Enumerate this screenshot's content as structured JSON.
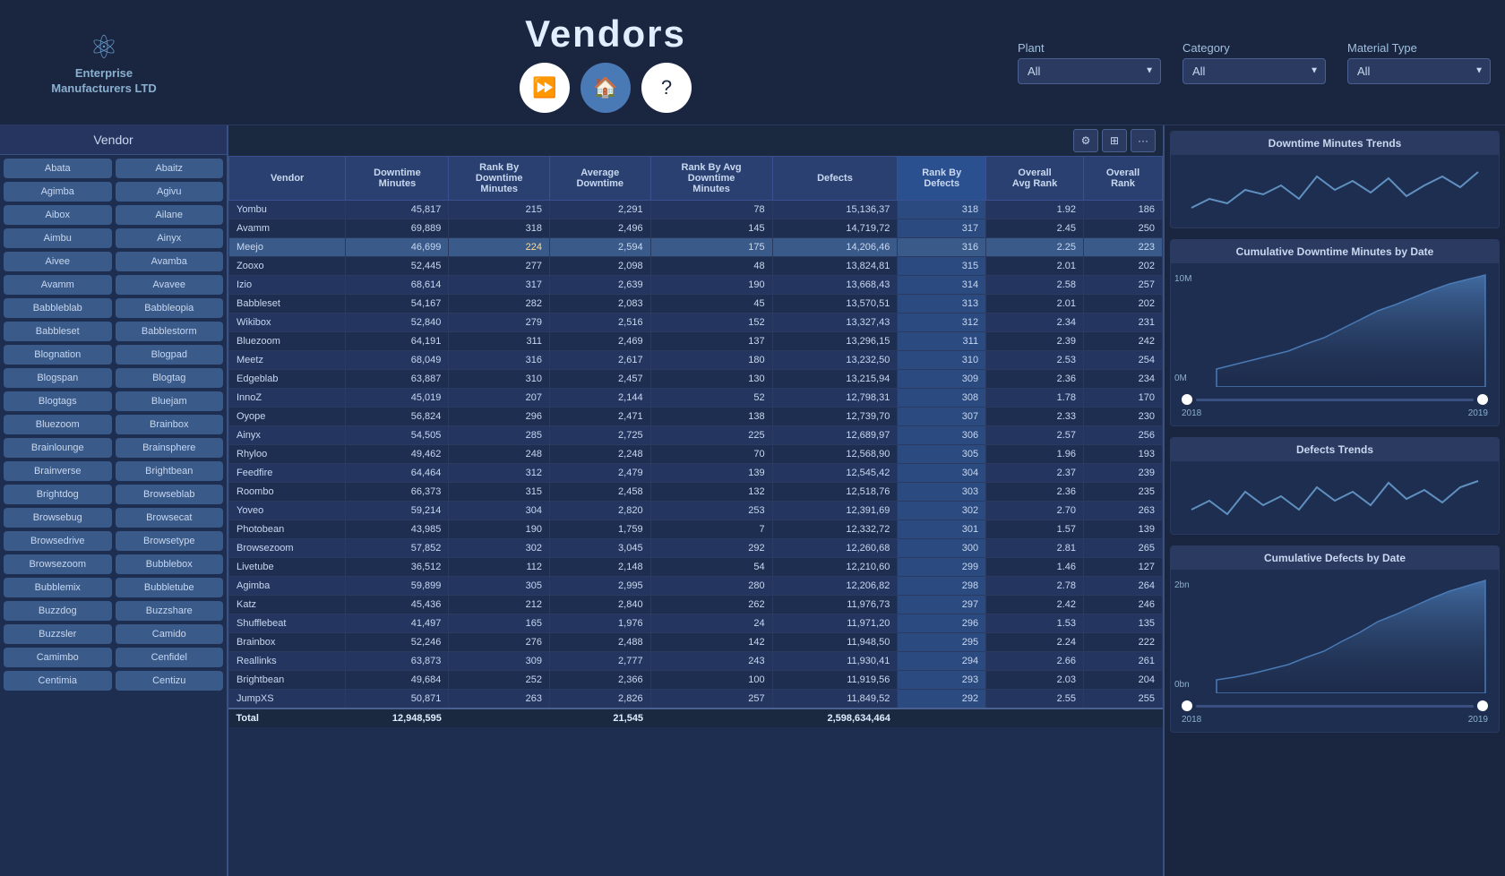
{
  "header": {
    "logo_line1": "Enterprise",
    "logo_line2": "Manufacturers LTD",
    "title": "Vendors",
    "nav": {
      "home_label": "🏠",
      "forward_label": "⏩",
      "help_label": "?"
    },
    "filters": {
      "plant_label": "Plant",
      "plant_value": "All",
      "category_label": "Category",
      "category_value": "All",
      "material_type_label": "Material Type",
      "material_type_value": "All"
    }
  },
  "sidebar": {
    "header": "Vendor",
    "vendors": [
      "Abata",
      "Abaitz",
      "Agimba",
      "Agivu",
      "Aibox",
      "Ailane",
      "Aimbu",
      "Ainyx",
      "Aivee",
      "Avamba",
      "Avamm",
      "Avavee",
      "Babbleblab",
      "Babbleopia",
      "Babbleset",
      "Babblestorm",
      "Blognation",
      "Blogpad",
      "Blogspan",
      "Blogtag",
      "Blogtags",
      "Bluejam",
      "Bluezoom",
      "Brainbox",
      "Brainlounge",
      "Brainsphere",
      "Brainverse",
      "Brightbean",
      "Brightdog",
      "Browseblab",
      "Browsebug",
      "Browsecat",
      "Browsedrive",
      "Browsetype",
      "Browsezoom",
      "Bubblebox",
      "Bubblemix",
      "Bubbletube",
      "Buzzdog",
      "Buzzshare",
      "Buzzsler",
      "Camido",
      "Camimbo",
      "Cenfidel",
      "Centimia",
      "Centizu"
    ]
  },
  "table": {
    "columns": [
      "Vendor",
      "Downtime Minutes",
      "Rank By Downtime Minutes",
      "Average Downtime",
      "Rank By Avg Downtime Minutes",
      "Defects",
      "Rank By Defects",
      "Overall Avg Rank",
      "Overall Rank"
    ],
    "rows": [
      {
        "vendor": "Yombu",
        "downtime": "45,817",
        "rank_down": "215",
        "avg_down": "2,291",
        "rank_avg": "78",
        "defects": "15,136,37",
        "rank_def": "318",
        "avg_rank": "1.92",
        "overall": "186"
      },
      {
        "vendor": "Avamm",
        "downtime": "69,889",
        "rank_down": "318",
        "avg_down": "2,496",
        "rank_avg": "145",
        "defects": "14,719,72",
        "rank_def": "317",
        "avg_rank": "2.45",
        "overall": "250"
      },
      {
        "vendor": "Meejo",
        "downtime": "46,699",
        "rank_down": "224",
        "avg_down": "2,594",
        "rank_avg": "175",
        "defects": "14,206,46",
        "rank_def": "316",
        "avg_rank": "2.25",
        "overall": "223",
        "highlight": true
      },
      {
        "vendor": "Zooxo",
        "downtime": "52,445",
        "rank_down": "277",
        "avg_down": "2,098",
        "rank_avg": "48",
        "defects": "13,824,81",
        "rank_def": "315",
        "avg_rank": "2.01",
        "overall": "202"
      },
      {
        "vendor": "Izio",
        "downtime": "68,614",
        "rank_down": "317",
        "avg_down": "2,639",
        "rank_avg": "190",
        "defects": "13,668,43",
        "rank_def": "314",
        "avg_rank": "2.58",
        "overall": "257"
      },
      {
        "vendor": "Babbleset",
        "downtime": "54,167",
        "rank_down": "282",
        "avg_down": "2,083",
        "rank_avg": "45",
        "defects": "13,570,51",
        "rank_def": "313",
        "avg_rank": "2.01",
        "overall": "202"
      },
      {
        "vendor": "Wikibox",
        "downtime": "52,840",
        "rank_down": "279",
        "avg_down": "2,516",
        "rank_avg": "152",
        "defects": "13,327,43",
        "rank_def": "312",
        "avg_rank": "2.34",
        "overall": "231"
      },
      {
        "vendor": "Bluezoom",
        "downtime": "64,191",
        "rank_down": "311",
        "avg_down": "2,469",
        "rank_avg": "137",
        "defects": "13,296,15",
        "rank_def": "311",
        "avg_rank": "2.39",
        "overall": "242"
      },
      {
        "vendor": "Meetz",
        "downtime": "68,049",
        "rank_down": "316",
        "avg_down": "2,617",
        "rank_avg": "180",
        "defects": "13,232,50",
        "rank_def": "310",
        "avg_rank": "2.53",
        "overall": "254"
      },
      {
        "vendor": "Edgeblab",
        "downtime": "63,887",
        "rank_down": "310",
        "avg_down": "2,457",
        "rank_avg": "130",
        "defects": "13,215,94",
        "rank_def": "309",
        "avg_rank": "2.36",
        "overall": "234"
      },
      {
        "vendor": "InnoZ",
        "downtime": "45,019",
        "rank_down": "207",
        "avg_down": "2,144",
        "rank_avg": "52",
        "defects": "12,798,31",
        "rank_def": "308",
        "avg_rank": "1.78",
        "overall": "170"
      },
      {
        "vendor": "Oyope",
        "downtime": "56,824",
        "rank_down": "296",
        "avg_down": "2,471",
        "rank_avg": "138",
        "defects": "12,739,70",
        "rank_def": "307",
        "avg_rank": "2.33",
        "overall": "230"
      },
      {
        "vendor": "Ainyx",
        "downtime": "54,505",
        "rank_down": "285",
        "avg_down": "2,725",
        "rank_avg": "225",
        "defects": "12,689,97",
        "rank_def": "306",
        "avg_rank": "2.57",
        "overall": "256"
      },
      {
        "vendor": "Rhyloo",
        "downtime": "49,462",
        "rank_down": "248",
        "avg_down": "2,248",
        "rank_avg": "70",
        "defects": "12,568,90",
        "rank_def": "305",
        "avg_rank": "1.96",
        "overall": "193"
      },
      {
        "vendor": "Feedfire",
        "downtime": "64,464",
        "rank_down": "312",
        "avg_down": "2,479",
        "rank_avg": "139",
        "defects": "12,545,42",
        "rank_def": "304",
        "avg_rank": "2.37",
        "overall": "239"
      },
      {
        "vendor": "Roombo",
        "downtime": "66,373",
        "rank_down": "315",
        "avg_down": "2,458",
        "rank_avg": "132",
        "defects": "12,518,76",
        "rank_def": "303",
        "avg_rank": "2.36",
        "overall": "235"
      },
      {
        "vendor": "Yoveo",
        "downtime": "59,214",
        "rank_down": "304",
        "avg_down": "2,820",
        "rank_avg": "253",
        "defects": "12,391,69",
        "rank_def": "302",
        "avg_rank": "2.70",
        "overall": "263"
      },
      {
        "vendor": "Photobean",
        "downtime": "43,985",
        "rank_down": "190",
        "avg_down": "1,759",
        "rank_avg": "7",
        "defects": "12,332,72",
        "rank_def": "301",
        "avg_rank": "1.57",
        "overall": "139"
      },
      {
        "vendor": "Browsezoom",
        "downtime": "57,852",
        "rank_down": "302",
        "avg_down": "3,045",
        "rank_avg": "292",
        "defects": "12,260,68",
        "rank_def": "300",
        "avg_rank": "2.81",
        "overall": "265"
      },
      {
        "vendor": "Livetube",
        "downtime": "36,512",
        "rank_down": "112",
        "avg_down": "2,148",
        "rank_avg": "54",
        "defects": "12,210,60",
        "rank_def": "299",
        "avg_rank": "1.46",
        "overall": "127"
      },
      {
        "vendor": "Agimba",
        "downtime": "59,899",
        "rank_down": "305",
        "avg_down": "2,995",
        "rank_avg": "280",
        "defects": "12,206,82",
        "rank_def": "298",
        "avg_rank": "2.78",
        "overall": "264"
      },
      {
        "vendor": "Katz",
        "downtime": "45,436",
        "rank_down": "212",
        "avg_down": "2,840",
        "rank_avg": "262",
        "defects": "11,976,73",
        "rank_def": "297",
        "avg_rank": "2.42",
        "overall": "246"
      },
      {
        "vendor": "Shufflebeat",
        "downtime": "41,497",
        "rank_down": "165",
        "avg_down": "1,976",
        "rank_avg": "24",
        "defects": "11,971,20",
        "rank_def": "296",
        "avg_rank": "1.53",
        "overall": "135"
      },
      {
        "vendor": "Brainbox",
        "downtime": "52,246",
        "rank_down": "276",
        "avg_down": "2,488",
        "rank_avg": "142",
        "defects": "11,948,50",
        "rank_def": "295",
        "avg_rank": "2.24",
        "overall": "222"
      },
      {
        "vendor": "Reallinks",
        "downtime": "63,873",
        "rank_down": "309",
        "avg_down": "2,777",
        "rank_avg": "243",
        "defects": "11,930,41",
        "rank_def": "294",
        "avg_rank": "2.66",
        "overall": "261"
      },
      {
        "vendor": "Brightbean",
        "downtime": "49,684",
        "rank_down": "252",
        "avg_down": "2,366",
        "rank_avg": "100",
        "defects": "11,919,56",
        "rank_def": "293",
        "avg_rank": "2.03",
        "overall": "204"
      },
      {
        "vendor": "JumpXS",
        "downtime": "50,871",
        "rank_down": "263",
        "avg_down": "2,826",
        "rank_avg": "257",
        "defects": "11,849,52",
        "rank_def": "292",
        "avg_rank": "2.55",
        "overall": "255"
      }
    ],
    "footer": {
      "label": "Total",
      "downtime": "12,948,595",
      "avg_down": "21,545",
      "defects": "2,598,634,464"
    }
  },
  "charts": {
    "downtime_trends": {
      "title": "Downtime Minutes Trends",
      "subtitle": "Cumulative Downtime Minutes by Date",
      "y_max": "10M",
      "y_min": "0M",
      "year_start": "2018",
      "year_end": "2019"
    },
    "defects_trends": {
      "title": "Defects Trends",
      "subtitle": "Cumulative Defects by Date",
      "y_max": "2bn",
      "y_min": "0bn",
      "year_start": "2018",
      "year_end": "2019"
    }
  }
}
